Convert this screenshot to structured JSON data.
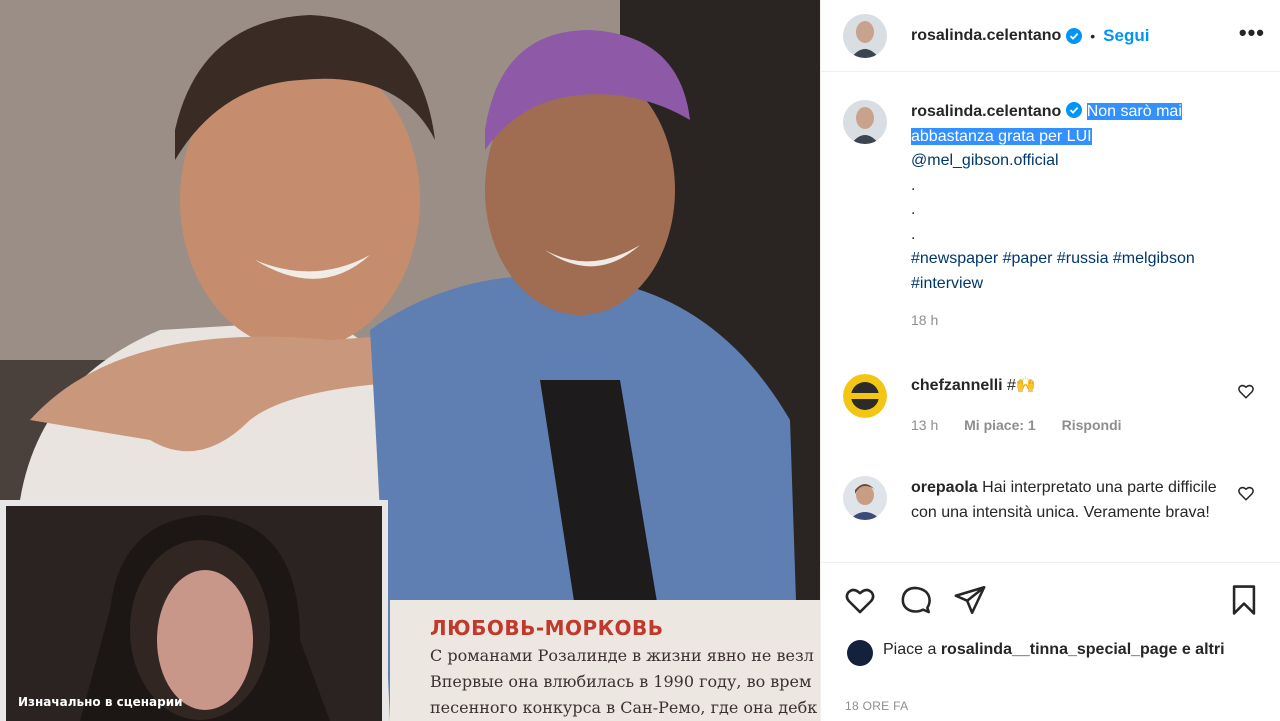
{
  "post": {
    "username": "rosalinda.celentano",
    "follow_label": "Segui",
    "more_label": "•••"
  },
  "caption": {
    "username": "rosalinda.celentano",
    "text_highlighted": "Non sarò mai abbastanza grata per LUI",
    "mention": "@mel_gibson.official",
    "dots": [
      ".",
      ".",
      "."
    ],
    "hashtags": "#newspaper #paper #russia #melgibson #interview",
    "time": "18 h"
  },
  "comments": [
    {
      "username": "chefzannelli",
      "text": "#🙌",
      "time": "13 h",
      "likes_label": "Mi piace: 1",
      "reply_label": "Rispondi"
    },
    {
      "username": "orepaola",
      "text": "Hai interpretato una parte difficile con una intensità unica. Veramente brava!"
    }
  ],
  "likes": {
    "prefix": "Piace a",
    "username": "rosalinda__tinna_special_page",
    "suffix": "e altri"
  },
  "post_date": "18 ORE FA",
  "clipping": {
    "heading": "ЛЮБОВЬ-МОРКОВЬ",
    "lines": [
      "С романами Розалинде в жизни явно не везл",
      "Впервые она влюбилась в 1990 году, во врем",
      "песенного конкурса в Сан-Ремо, где она дебк"
    ],
    "caption": "Изначально в сценарии"
  },
  "colors": {
    "accent": "#0095f6",
    "highlight": "#3390ff",
    "link": "#00376b",
    "muted": "#8e8e8e"
  },
  "icons": [
    "verified-icon",
    "heart-icon",
    "comment-icon",
    "share-icon",
    "bookmark-icon",
    "more-icon"
  ]
}
